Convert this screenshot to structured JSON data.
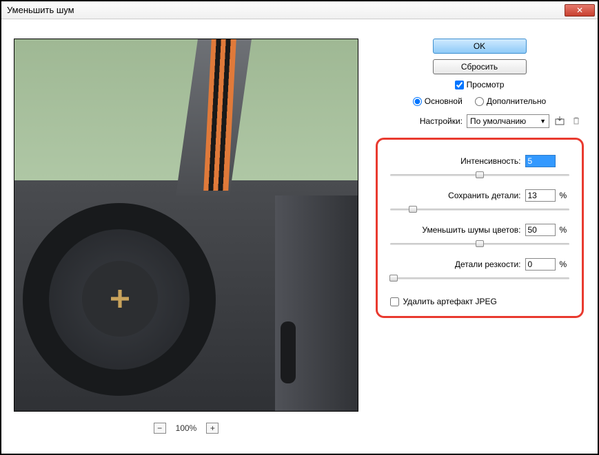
{
  "title": "Уменьшить шум",
  "buttons": {
    "ok": "OK",
    "reset": "Сбросить"
  },
  "preview_label": "Просмотр",
  "preview_checked": true,
  "mode": {
    "basic": "Основной",
    "advanced": "Дополнительно",
    "selected": "basic"
  },
  "settings": {
    "label": "Настройки:",
    "value": "По умолчанию"
  },
  "sliders": {
    "intensity": {
      "label": "Интенсивность:",
      "value": "5",
      "percent": "",
      "pos": 50
    },
    "details": {
      "label": "Сохранить детали:",
      "value": "13",
      "percent": "%",
      "pos": 13
    },
    "color_noise": {
      "label": "Уменьшить шумы цветов:",
      "value": "50",
      "percent": "%",
      "pos": 50
    },
    "sharpen": {
      "label": "Детали резкости:",
      "value": "0",
      "percent": "%",
      "pos": 0
    }
  },
  "jpeg_artifact": {
    "label": "Удалить артефакт JPEG",
    "checked": false
  },
  "zoom": {
    "level": "100%"
  }
}
